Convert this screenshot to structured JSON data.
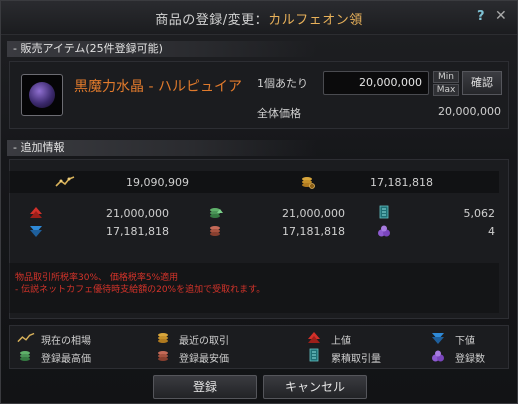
{
  "window": {
    "title_prefix": "商品の登録/変更：",
    "title_accent": "カルフェオン領",
    "help": "?",
    "close": "✕"
  },
  "sale_section": {
    "heading": "- 販売アイテム(25件登録可能)"
  },
  "item": {
    "name": "黒魔力水晶 - ハルピュイア",
    "unit_price_label": "1個あたり",
    "unit_price_value": "20,000,000",
    "min_label": "Min",
    "max_label": "Max",
    "confirm_label": "確認",
    "total_label": "全体価格",
    "total_value": "20,000,000"
  },
  "extra_section": {
    "heading": "- 追加情報"
  },
  "stats": {
    "current_price": "19,090,909",
    "recent_trade": "17,181,818",
    "highest_registered": "21,000,000",
    "lowest_registered": "17,181,818",
    "upper_limit": "21,000,000",
    "lower_limit": "17,181,818",
    "cumulative_trades": "5,062",
    "registered_count": "4"
  },
  "notices": [
    "物品取引所税率30%、 価格税率5%適用",
    "- 伝説ネットカフェ優待時支給額の20%を追加で受取れます。"
  ],
  "legend": {
    "current_price": "現在の相場",
    "recent_trade": "最近の取引",
    "upper": "上値",
    "lower": "下値",
    "highest": "登録最高価",
    "lowest": "登録最安価",
    "cumulative": "累積取引量",
    "count": "登録数"
  },
  "buttons": {
    "register": "登録",
    "cancel": "キャンセル"
  },
  "colors": {
    "accent": "#e8b15a",
    "item_name": "#e07a2c",
    "notice": "#d3332a",
    "up": "#d2302a",
    "down": "#2f8ad8"
  }
}
